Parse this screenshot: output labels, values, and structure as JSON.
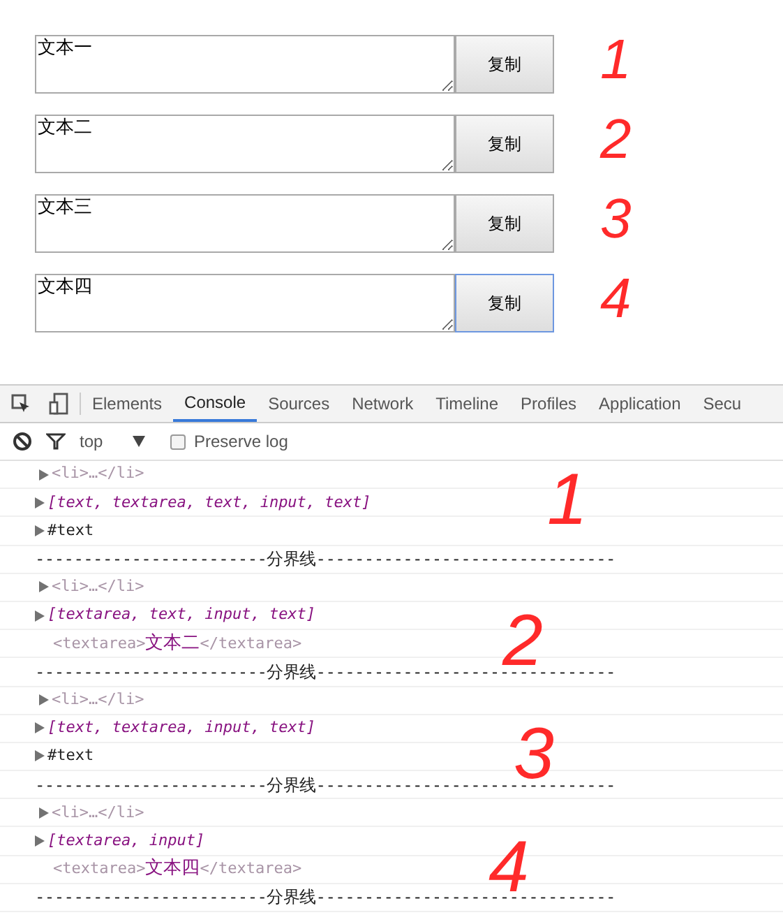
{
  "fields": [
    {
      "value": "文本一",
      "button": "复制",
      "focused": false,
      "annotation": "1"
    },
    {
      "value": "文本二",
      "button": "复制",
      "focused": false,
      "annotation": "2"
    },
    {
      "value": "文本三",
      "button": "复制",
      "focused": false,
      "annotation": "3"
    },
    {
      "value": "文本四",
      "button": "复制",
      "focused": true,
      "annotation": "4"
    }
  ],
  "devtools": {
    "tabs": [
      {
        "label": "Elements",
        "selected": false
      },
      {
        "label": "Console",
        "selected": true
      },
      {
        "label": "Sources",
        "selected": false
      },
      {
        "label": "Network",
        "selected": false
      },
      {
        "label": "Timeline",
        "selected": false
      },
      {
        "label": "Profiles",
        "selected": false
      },
      {
        "label": "Application",
        "selected": false
      },
      {
        "label": "Secu",
        "selected": false
      }
    ],
    "toolbar": {
      "context": "top",
      "preserve_log": {
        "label": "Preserve log",
        "checked": false
      }
    },
    "console": [
      {
        "kind": "node",
        "text": "<li>…</li>"
      },
      {
        "kind": "array",
        "text": "[text, textarea, text, input, text]"
      },
      {
        "kind": "text",
        "text": "#text"
      },
      {
        "kind": "separator",
        "text": "------------------------分界线-------------------------------"
      },
      {
        "kind": "node",
        "text": "<li>…</li>"
      },
      {
        "kind": "array",
        "text": "[textarea, text, input, text]"
      },
      {
        "kind": "element",
        "open": "<textarea>",
        "content": "文本二",
        "close": "</textarea>"
      },
      {
        "kind": "separator",
        "text": "------------------------分界线-------------------------------"
      },
      {
        "kind": "node",
        "text": "<li>…</li>"
      },
      {
        "kind": "array",
        "text": "[text, textarea, input, text]"
      },
      {
        "kind": "text",
        "text": "#text"
      },
      {
        "kind": "separator",
        "text": "------------------------分界线-------------------------------"
      },
      {
        "kind": "node",
        "text": "<li>…</li>"
      },
      {
        "kind": "array",
        "text": "[textarea, input]"
      },
      {
        "kind": "element",
        "open": "<textarea>",
        "content": "文本四",
        "close": "</textarea>"
      },
      {
        "kind": "separator",
        "text": "------------------------分界线-------------------------------"
      }
    ],
    "annotations": [
      "1",
      "2",
      "3",
      "4"
    ]
  }
}
